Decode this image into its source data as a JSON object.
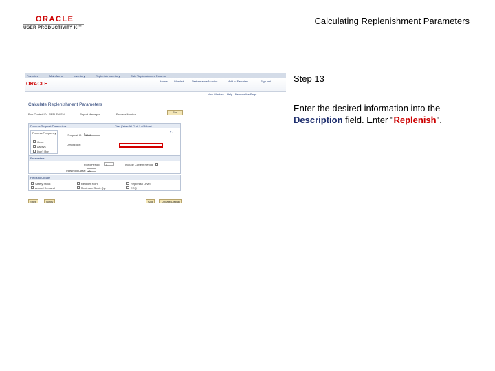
{
  "header": {
    "logo_name": "ORACLE",
    "logo_sub": "USER PRODUCTIVITY KIT",
    "title": "Calculating Replenishment Parameters"
  },
  "step": {
    "label": "Step 13"
  },
  "instruction": {
    "text_before": "Enter the desired information into the ",
    "field_name": "Description",
    "text_middle": " field. Enter \"",
    "value": "Replenish",
    "text_after": "\"."
  },
  "thumbnail": {
    "nav": [
      "Favorites",
      "Main Menu",
      "Inventory",
      "Replenish Inventory",
      "Calc Replenishment Params"
    ],
    "brand": "ORACLE",
    "brand_links": [
      "Home",
      "Worklist",
      "Performance Monitor",
      "Add to Favorites",
      "Sign out"
    ],
    "sub_links": [
      "New Window",
      "Help",
      "Personalize Page"
    ],
    "page_title": "Calculate Replenishment Parameters",
    "run_control_label": "Run Control ID:",
    "run_control_value": "REPLENISH",
    "report_manager": "Report Manager",
    "process_monitor": "Process Monitor",
    "run_button": "Run",
    "params_header": "Process Request Parameters",
    "find_links": "Find | View All   First 1 of 1 Last",
    "process_frequency": "Process Frequency",
    "freq_options": [
      "Once",
      "Always",
      "Don't Run"
    ],
    "request_id_label": "*Request ID:",
    "request_id_value": "1000",
    "description_label": "Description:",
    "parameters_header": "Parameters",
    "fixed_label": "Fixed Period:",
    "fixed_value": "4",
    "include_label": "Include Current Period:",
    "threshold_label": "Threshold Class:",
    "threshold_value": "20",
    "update_header": "Fields to Update",
    "update_items": [
      "Safety Stock",
      "Reorder Point",
      "Replenish Level",
      "Annual Demand",
      "Maximum Stock Qty",
      "EOQ"
    ],
    "bottom_buttons": [
      "Save",
      "Notify",
      "Add",
      "Update/Display"
    ]
  }
}
